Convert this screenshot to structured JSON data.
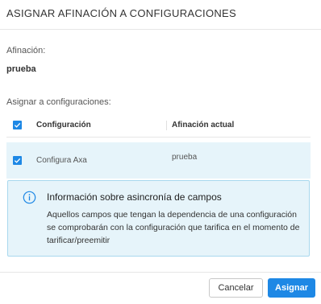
{
  "dialog": {
    "title": "ASIGNAR AFINACIÓN A CONFIGURACIONES",
    "afinacion_label": "Afinación:",
    "afinacion_value": "prueba",
    "assign_label": "Asignar a configuraciones:"
  },
  "table": {
    "columns": [
      "Configuración",
      "Afinación actual"
    ],
    "header_checked": true,
    "rows": [
      {
        "checked": true,
        "configuracion": "Configura Axa",
        "afinacion_actual": "prueba"
      }
    ]
  },
  "info": {
    "icon": "info-circle-icon",
    "title": "Información sobre asincronía de campos",
    "body": "Aquellos campos que tengan la dependencia de una configuración se comprobarán con la configuración que tarifica en el momento de tarificar/preemitir"
  },
  "footer": {
    "cancel_label": "Cancelar",
    "assign_label": "Asignar"
  },
  "colors": {
    "accent": "#1e88e5",
    "row_highlight": "#e6f4fa",
    "info_border": "#a8d8ee"
  }
}
